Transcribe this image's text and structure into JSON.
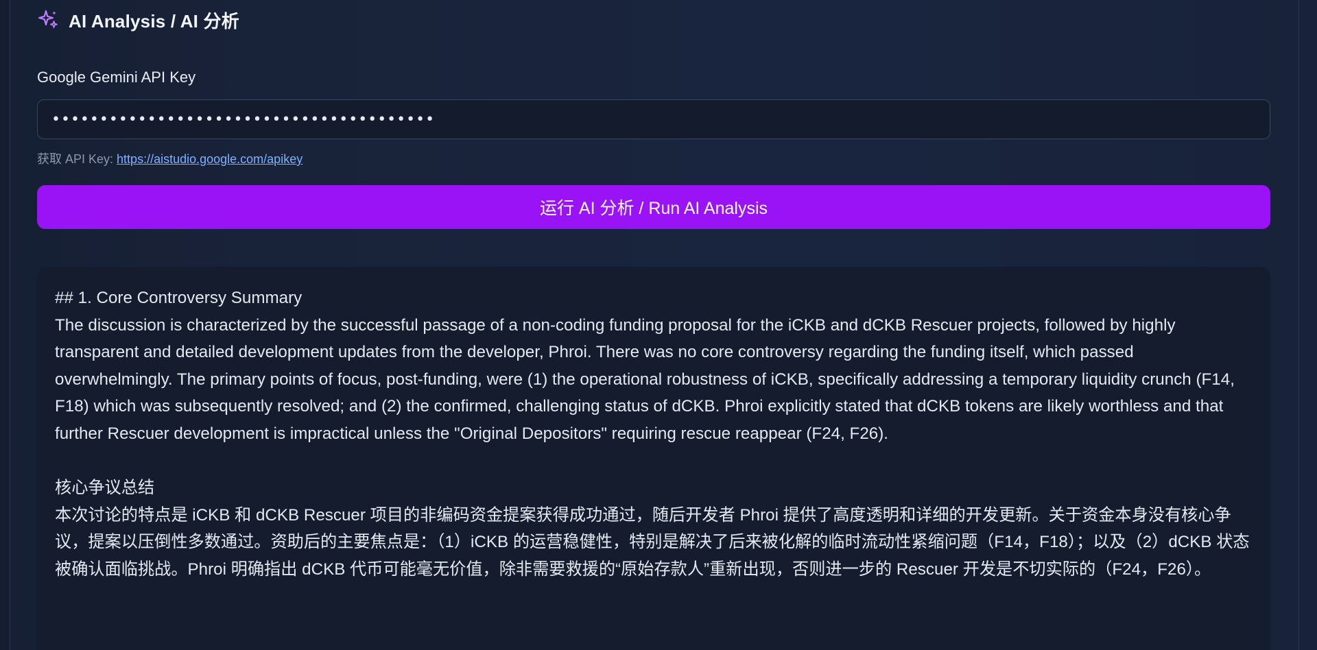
{
  "header": {
    "icon": "sparkles-icon",
    "title": "AI Analysis / AI 分析",
    "icon_color": "#c07cff"
  },
  "api_key": {
    "label": "Google Gemini API Key",
    "value": "••••••••••••••••••••••••••••••••••••••••",
    "hint_prefix": "获取 API Key:",
    "hint_link": "https://aistudio.google.com/apikey"
  },
  "run_button": {
    "label": "运行 AI 分析 / Run AI Analysis",
    "color": "#9a12f6"
  },
  "result": {
    "heading": "## 1. Core Controversy Summary",
    "en_paragraph": "The discussion is characterized by the successful passage of a non-coding funding proposal for the iCKB and dCKB Rescuer projects, followed by highly transparent and detailed development updates from the developer, Phroi. There was no core controversy regarding the funding itself, which passed overwhelmingly. The primary points of focus, post-funding, were (1) the operational robustness of iCKB, specifically addressing a temporary liquidity crunch (F14, F18) which was subsequently resolved; and (2) the confirmed, challenging status of dCKB. Phroi explicitly stated that dCKB tokens are likely worthless and that further Rescuer development is impractical unless the \"Original Depositors\" requiring rescue reappear (F24, F26).",
    "zh_heading": "核心争议总结",
    "zh_paragraph": "本次讨论的特点是 iCKB 和 dCKB Rescuer 项目的非编码资金提案获得成功通过，随后开发者 Phroi 提供了高度透明和详细的开发更新。关于资金本身没有核心争议，提案以压倒性多数通过。资助后的主要焦点是：（1）iCKB 的运营稳健性，特别是解决了后来被化解的临时流动性紧缩问题（F14，F18）；以及（2）dCKB 状态被确认面临挑战。Phroi 明确指出 dCKB 代币可能毫无价值，除非需要救援的“原始存款人”重新出现，否则进一步的 Rescuer 开发是不切实际的（F24，F26）。"
  }
}
